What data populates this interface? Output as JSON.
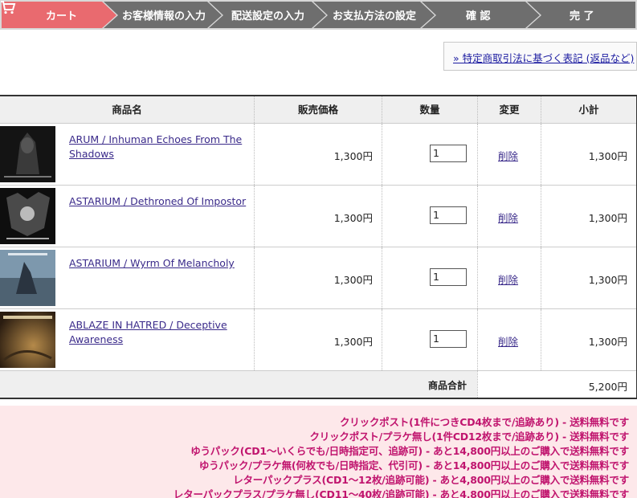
{
  "steps": {
    "cart": "カート",
    "customer": "お客様情報の入力",
    "delivery": "配送設定の入力",
    "payment": "お支払方法の設定",
    "confirm": "確 認",
    "complete": "完 了"
  },
  "legal_link": "» 特定商取引法に基づく表記 (返品など)",
  "table": {
    "headers": {
      "product": "商品名",
      "price": "販売価格",
      "qty": "数量",
      "change": "変更",
      "subtotal": "小計"
    },
    "rows": [
      {
        "name": "ARUM / Inhuman Echoes From The Shadows",
        "price": "1,300円",
        "qty": "1",
        "action": "削除",
        "subtotal": "1,300円"
      },
      {
        "name": "ASTARIUM / Dethroned Of Impostor",
        "price": "1,300円",
        "qty": "1",
        "action": "削除",
        "subtotal": "1,300円"
      },
      {
        "name": "ASTARIUM / Wyrm Of Melancholy",
        "price": "1,300円",
        "qty": "1",
        "action": "削除",
        "subtotal": "1,300円"
      },
      {
        "name": "ABLAZE IN HATRED / Deceptive Awareness",
        "price": "1,300円",
        "qty": "1",
        "action": "削除",
        "subtotal": "1,300円"
      }
    ],
    "total_label": "商品合計",
    "total_value": "5,200円"
  },
  "shipping_notes": [
    "クリックポスト(1件につきCD4枚まで/追跡あり) - 送料無料です",
    "クリックポスト/プラケ無し(1件CD12枚まで/追跡あり) - 送料無料です",
    "ゆうパック(CD1～いくらでも/日時指定可、追跡可) - あと14,800円以上のご購入で送料無料です",
    "ゆうパック/プラケ無(何枚でも/日時指定、代引可) - あと14,800円以上のご購入で送料無料です",
    "レターパックプラス(CD1～12枚/追跡可能) - あと4,800円以上のご購入で送料無料です",
    "レターパックプラス/プラケ無し(CD11～40枚/追跡可能) - あと4,800円以上のご購入で送料無料です"
  ],
  "colors": {
    "active_step": "#e96a6f",
    "inactive_step": "#6e6e6e",
    "link": "#3a2a8a",
    "notice_text": "#c0146e",
    "notice_bg": "#fde8ea"
  },
  "icons": [
    "cart-icon",
    "step-arrow"
  ]
}
